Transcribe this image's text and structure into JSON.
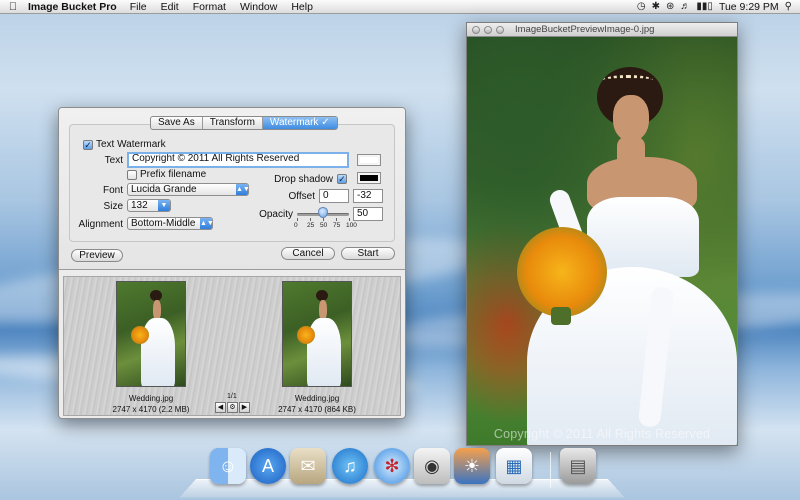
{
  "menubar": {
    "app_name": "Image Bucket Pro",
    "menus": [
      "File",
      "Edit",
      "Format",
      "Window",
      "Help"
    ],
    "clock": "Tue 9:29 PM"
  },
  "panel": {
    "tabs": [
      {
        "label": "Save As",
        "active": false
      },
      {
        "label": "Transform",
        "active": false
      },
      {
        "label": "Watermark ✓",
        "active": true
      }
    ],
    "text_watermark_label": "Text Watermark",
    "text_watermark_checked": true,
    "text_label": "Text",
    "text_value": "Copyright © 2011 All Rights Reserved",
    "prefix_filename_label": "Prefix filename",
    "prefix_filename_checked": false,
    "font_label": "Font",
    "font_value": "Lucida Grande",
    "size_label": "Size",
    "size_value": "132",
    "alignment_label": "Alignment",
    "alignment_value": "Bottom-Middle",
    "drop_shadow_label": "Drop shadow",
    "drop_shadow_checked": true,
    "text_color": "#ffffff",
    "shadow_color": "#000000",
    "offset_label": "Offset",
    "offset_x": "0",
    "offset_y": "-32",
    "opacity_label": "Opacity",
    "opacity_value": "50",
    "opacity_ticks": [
      "0",
      "25",
      "50",
      "75",
      "100"
    ],
    "preview_button": "Preview",
    "cancel_button": "Cancel",
    "start_button": "Start"
  },
  "thumbnails": [
    {
      "filename": "Wedding.jpg",
      "info": "2747 x 4170 (2.2 MB)"
    },
    {
      "filename": "Wedding.jpg",
      "info": "2747 x 4170 (864 KB)"
    }
  ],
  "pager": {
    "label": "1/1",
    "icons": [
      "prev-icon",
      "settings-icon",
      "next-icon"
    ]
  },
  "preview_window": {
    "title": "ImageBucketPreviewImage-0.jpg",
    "watermark": "Copyright © 2011 All Rights Reserved"
  },
  "dock": {
    "icons": [
      "finder-icon",
      "app-store-icon",
      "mail-icon",
      "itunes-icon",
      "safari-icon",
      "photo-booth-icon",
      "iphoto-icon",
      "image-bucket-icon",
      "trash-icon"
    ]
  }
}
